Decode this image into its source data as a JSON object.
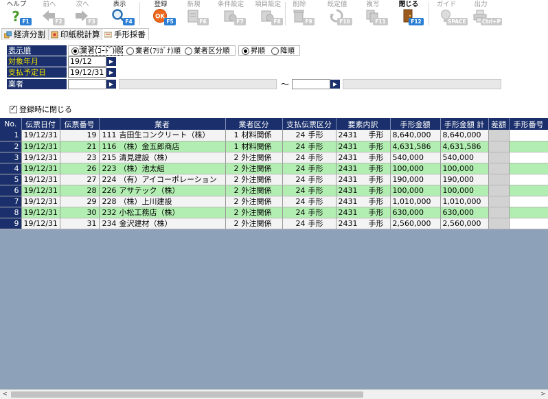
{
  "toolbar": {
    "buttons": [
      {
        "label": "ヘルプ",
        "key": "F1"
      },
      {
        "label": "前へ",
        "key": "F2"
      },
      {
        "label": "次へ",
        "key": "F3"
      },
      {
        "label": "表示",
        "key": "F4"
      },
      {
        "label": "登録",
        "key": "F5"
      },
      {
        "label": "新規",
        "key": "F6"
      },
      {
        "label": "条件設定",
        "key": "F7"
      },
      {
        "label": "項目設定",
        "key": "F8"
      },
      {
        "label": "削除",
        "key": "F9"
      },
      {
        "label": "既定値",
        "key": "F10"
      },
      {
        "label": "複写",
        "key": "F11"
      },
      {
        "label": "閉じる",
        "key": "F12"
      },
      {
        "label": "ガイド",
        "key": "SPACE"
      },
      {
        "label": "出力",
        "key": "Ctrl+P"
      }
    ]
  },
  "tabs": [
    {
      "label": "経済分割"
    },
    {
      "label": "印紙税計算"
    },
    {
      "label": "手形採番"
    }
  ],
  "form": {
    "sort_label": "表示順",
    "sort_options": [
      "業者(ｺｰﾄﾞ)順",
      "業者(ﾌﾘｶﾞﾅ)順",
      "業者区分順"
    ],
    "order_options": [
      "昇順",
      "降順"
    ],
    "month_label": "対象年月",
    "month_value": "19/12",
    "date_label": "支払予定日",
    "date_value": "19/12/31",
    "vendor_label": "業者",
    "vendor_from": "",
    "vendor_to": "",
    "range_sep": "～",
    "close_on_save": "登録時に閉じる"
  },
  "grid": {
    "columns": [
      "No.",
      "伝票日付",
      "伝票番号",
      "業者",
      "業者区分",
      "支払伝票区分",
      "要素内訳",
      "手形金額",
      "手形金額 計",
      "差額",
      "手形番号"
    ],
    "rows": [
      {
        "no": "1",
        "date": "19/12/31",
        "slip": "19",
        "vcode": "111",
        "vname": "吉田生コンクリート（株）",
        "ccode": "1",
        "cname": "材料関係",
        "pcode": "24",
        "pname": "手形",
        "ecode": "2431",
        "ename": "手形",
        "amount": "8,640,000",
        "total": "8,640,000",
        "diff": "",
        "billno": ""
      },
      {
        "no": "2",
        "date": "19/12/31",
        "slip": "21",
        "vcode": "116",
        "vname": "（株）金五郎商店",
        "ccode": "1",
        "cname": "材料関係",
        "pcode": "24",
        "pname": "手形",
        "ecode": "2431",
        "ename": "手形",
        "amount": "4,631,586",
        "total": "4,631,586",
        "diff": "",
        "billno": ""
      },
      {
        "no": "3",
        "date": "19/12/31",
        "slip": "23",
        "vcode": "215",
        "vname": "清見建設（株）",
        "ccode": "2",
        "cname": "外注関係",
        "pcode": "24",
        "pname": "手形",
        "ecode": "2431",
        "ename": "手形",
        "amount": "540,000",
        "total": "540,000",
        "diff": "",
        "billno": ""
      },
      {
        "no": "4",
        "date": "19/12/31",
        "slip": "26",
        "vcode": "223",
        "vname": "（株）池太組",
        "ccode": "2",
        "cname": "外注関係",
        "pcode": "24",
        "pname": "手形",
        "ecode": "2431",
        "ename": "手形",
        "amount": "100,000",
        "total": "100,000",
        "diff": "",
        "billno": ""
      },
      {
        "no": "5",
        "date": "19/12/31",
        "slip": "27",
        "vcode": "224",
        "vname": "（有）アイコーポレーション",
        "ccode": "2",
        "cname": "外注関係",
        "pcode": "24",
        "pname": "手形",
        "ecode": "2431",
        "ename": "手形",
        "amount": "190,000",
        "total": "190,000",
        "diff": "",
        "billno": ""
      },
      {
        "no": "6",
        "date": "19/12/31",
        "slip": "28",
        "vcode": "226",
        "vname": "アサテック（株）",
        "ccode": "2",
        "cname": "外注関係",
        "pcode": "24",
        "pname": "手形",
        "ecode": "2431",
        "ename": "手形",
        "amount": "100,000",
        "total": "100,000",
        "diff": "",
        "billno": ""
      },
      {
        "no": "7",
        "date": "19/12/31",
        "slip": "29",
        "vcode": "228",
        "vname": "（株）上川建設",
        "ccode": "2",
        "cname": "外注関係",
        "pcode": "24",
        "pname": "手形",
        "ecode": "2431",
        "ename": "手形",
        "amount": "1,010,000",
        "total": "1,010,000",
        "diff": "",
        "billno": ""
      },
      {
        "no": "8",
        "date": "19/12/31",
        "slip": "30",
        "vcode": "232",
        "vname": "小松工務店（株）",
        "ccode": "2",
        "cname": "外注関係",
        "pcode": "24",
        "pname": "手形",
        "ecode": "2431",
        "ename": "手形",
        "amount": "630,000",
        "total": "630,000",
        "diff": "",
        "billno": ""
      },
      {
        "no": "9",
        "date": "19/12/31",
        "slip": "31",
        "vcode": "234",
        "vname": "金沢建材（株）",
        "ccode": "2",
        "cname": "外注関係",
        "pcode": "24",
        "pname": "手形",
        "ecode": "2431",
        "ename": "手形",
        "amount": "2,560,000",
        "total": "2,560,000",
        "diff": "",
        "billno": ""
      }
    ]
  },
  "scrollbar": {
    "left_arrow": "<",
    "right_arrow": ">"
  },
  "colors": {
    "header": "#1a2f6b",
    "row_odd": "#f3f3f3",
    "row_even": "#b2eeb2",
    "grid_bg": "#8da1b9",
    "key_badge": "#2a7fd4",
    "label_yellow": "#f2e300"
  }
}
